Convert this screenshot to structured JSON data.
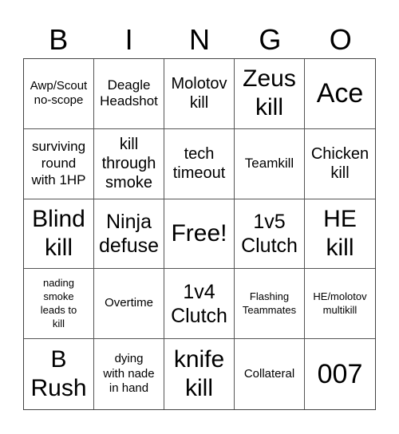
{
  "header": {
    "letters": [
      "B",
      "I",
      "N",
      "G",
      "O"
    ]
  },
  "cells": [
    {
      "text": "Awp/Scout\nno-scope",
      "size": "s-sm"
    },
    {
      "text": "Deagle\nHeadshot",
      "size": "s-md"
    },
    {
      "text": "Molotov\nkill",
      "size": "s-lg"
    },
    {
      "text": "Zeus\nkill",
      "size": "s-xxl"
    },
    {
      "text": "Ace",
      "size": "s-xxxl"
    },
    {
      "text": "surviving\nround\nwith 1HP",
      "size": "s-md"
    },
    {
      "text": "kill\nthrough\nsmoke",
      "size": "s-lg"
    },
    {
      "text": "tech\ntimeout",
      "size": "s-lg"
    },
    {
      "text": "Teamkill",
      "size": "s-md"
    },
    {
      "text": "Chicken\nkill",
      "size": "s-lg"
    },
    {
      "text": "Blind\nkill",
      "size": "s-xxl"
    },
    {
      "text": "Ninja\ndefuse",
      "size": "s-xl"
    },
    {
      "text": "Free!",
      "size": "s-xxl"
    },
    {
      "text": "1v5\nClutch",
      "size": "s-xl"
    },
    {
      "text": "HE\nkill",
      "size": "s-xxl"
    },
    {
      "text": "nading\nsmoke\nleads to\nkill",
      "size": "s-xs"
    },
    {
      "text": "Overtime",
      "size": "s-sm"
    },
    {
      "text": "1v4\nClutch",
      "size": "s-xl"
    },
    {
      "text": "Flashing\nTeammates",
      "size": "s-xs"
    },
    {
      "text": "HE/molotov\nmultikill",
      "size": "s-xs"
    },
    {
      "text": "B\nRush",
      "size": "s-xxl"
    },
    {
      "text": "dying\nwith nade\nin hand",
      "size": "s-sm"
    },
    {
      "text": "knife\nkill",
      "size": "s-xxl"
    },
    {
      "text": "Collateral",
      "size": "s-sm"
    },
    {
      "text": "007",
      "size": "s-xxxl"
    }
  ]
}
